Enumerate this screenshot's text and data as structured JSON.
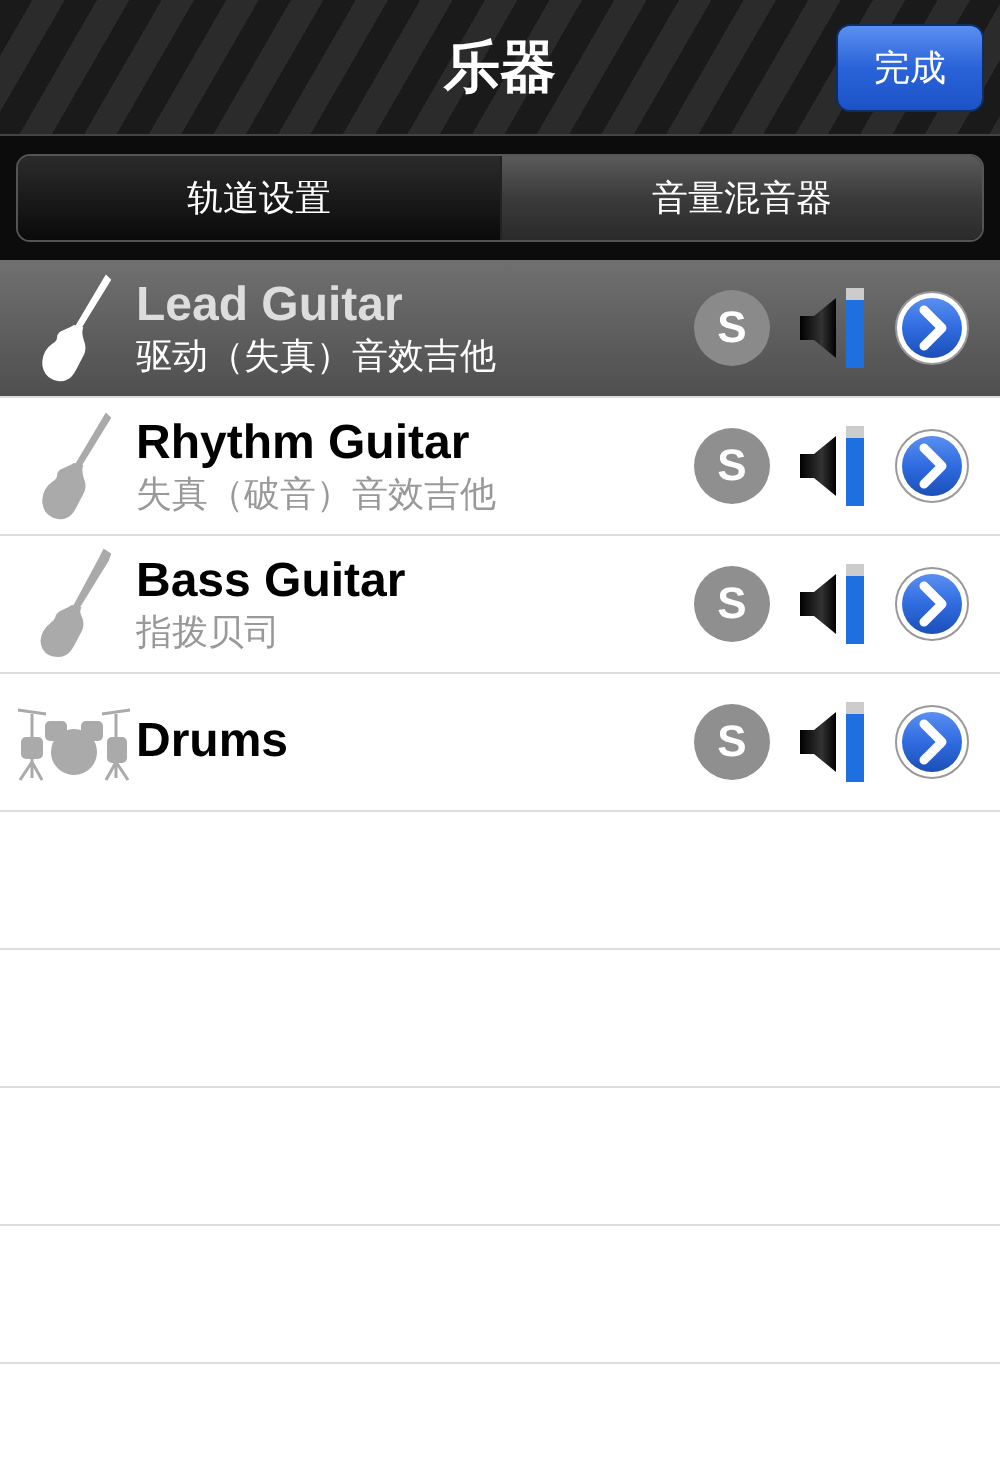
{
  "nav_bar": {
    "title": "乐器",
    "done_button": "完成"
  },
  "tabs": [
    {
      "label": "轨道设置",
      "selected": true
    },
    {
      "label": "音量混音器",
      "selected": false
    }
  ],
  "tracks": [
    {
      "kind": "guitar",
      "name": "Lead Guitar",
      "subtitle": "驱动（失真）音效吉他",
      "selected": true,
      "solo": "S",
      "level": 0.85
    },
    {
      "kind": "guitar",
      "name": "Rhythm Guitar",
      "subtitle": "失真（破音）音效吉他",
      "selected": false,
      "solo": "S",
      "level": 0.85
    },
    {
      "kind": "bass",
      "name": "Bass Guitar",
      "subtitle": "指拨贝司",
      "selected": false,
      "solo": "S",
      "level": 0.85
    },
    {
      "kind": "drums",
      "name": "Drums",
      "selected": false,
      "solo": "S",
      "level": 0.85
    }
  ]
}
